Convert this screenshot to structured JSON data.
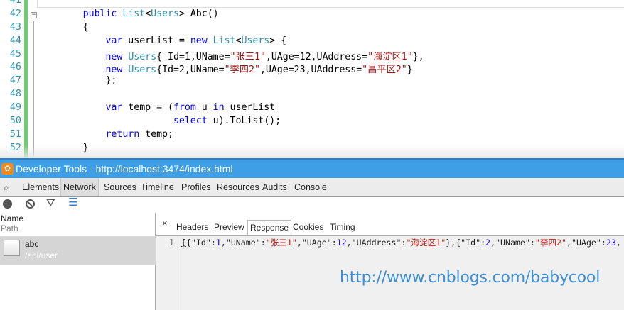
{
  "editor": {
    "line_numbers": [
      "41",
      "42",
      "43",
      "44",
      "45",
      "46",
      "47",
      "48",
      "49",
      "50",
      "51",
      "52"
    ],
    "fold_icon": "minus-box-icon",
    "lines": [
      [],
      [
        [
          "        ",
          "pl"
        ],
        [
          "public",
          "kw"
        ],
        [
          " ",
          "pl"
        ],
        [
          "List",
          "ty"
        ],
        [
          "<",
          "pl"
        ],
        [
          "Users",
          "ty"
        ],
        [
          "> Abc()",
          "pl"
        ]
      ],
      [
        [
          "        {",
          "pl"
        ]
      ],
      [
        [
          "            ",
          "pl"
        ],
        [
          "var",
          "kw"
        ],
        [
          " userList = ",
          "pl"
        ],
        [
          "new",
          "kw"
        ],
        [
          " ",
          "pl"
        ],
        [
          "List",
          "ty"
        ],
        [
          "<",
          "pl"
        ],
        [
          "Users",
          "ty"
        ],
        [
          "> {",
          "pl"
        ]
      ],
      [
        [
          "            ",
          "pl"
        ],
        [
          "new",
          "kw"
        ],
        [
          " ",
          "pl"
        ],
        [
          "Users",
          "ty"
        ],
        [
          "{ Id=1,UName=",
          "pl"
        ],
        [
          "\"张三1\"",
          "st"
        ],
        [
          ",UAge=12,UAddress=",
          "pl"
        ],
        [
          "\"海淀区1\"",
          "st"
        ],
        [
          "},",
          "pl"
        ]
      ],
      [
        [
          "            ",
          "pl"
        ],
        [
          "new",
          "kw"
        ],
        [
          " ",
          "pl"
        ],
        [
          "Users",
          "ty"
        ],
        [
          "{Id=2,UName=",
          "pl"
        ],
        [
          "\"李四2\"",
          "st"
        ],
        [
          ",UAge=23,UAddress=",
          "pl"
        ],
        [
          "\"昌平区2\"",
          "st"
        ],
        [
          "}",
          "pl"
        ]
      ],
      [
        [
          "            };",
          "pl"
        ]
      ],
      [],
      [
        [
          "            ",
          "pl"
        ],
        [
          "var",
          "kw"
        ],
        [
          " temp = (",
          "pl"
        ],
        [
          "from",
          "kw"
        ],
        [
          " u ",
          "pl"
        ],
        [
          "in",
          "kw"
        ],
        [
          " userList",
          "pl"
        ]
      ],
      [
        [
          "                        ",
          "pl"
        ],
        [
          "select",
          "kw"
        ],
        [
          " u).ToList();",
          "pl"
        ]
      ],
      [
        [
          "            ",
          "pl"
        ],
        [
          "return",
          "kw"
        ],
        [
          " temp;",
          "pl"
        ]
      ],
      [
        [
          "        }",
          "pl"
        ]
      ]
    ]
  },
  "devtools": {
    "title": "Developer Tools - http://localhost:3474/index.html",
    "app_icon": "uc-browser-icon",
    "tabs": [
      "Elements",
      "Network",
      "Sources",
      "Timeline",
      "Profiles",
      "Resources",
      "Audits",
      "Console"
    ],
    "active_tab": "Network",
    "toolbar_icons": [
      "record-icon",
      "clear-icon",
      "filter-icon",
      "list-view-icon"
    ],
    "list_header": {
      "name": "Name",
      "path": "Path"
    },
    "requests": [
      {
        "name": "abc",
        "path": "/api/user",
        "selected": true
      }
    ],
    "detail_tabs": [
      "Headers",
      "Preview",
      "Response",
      "Cookies",
      "Timing"
    ],
    "active_detail_tab": "Response",
    "close_label": "×",
    "response_line_number": "1",
    "response_tokens": [
      [
        "[",
        "jp"
      ],
      [
        "{",
        "jp"
      ],
      [
        "\"Id\"",
        "jk"
      ],
      [
        ":",
        "jp"
      ],
      [
        "1",
        "jn"
      ],
      [
        ",",
        "jp"
      ],
      [
        "\"UName\"",
        "jk"
      ],
      [
        ":",
        "jp"
      ],
      [
        "\"张三1\"",
        "js"
      ],
      [
        ",",
        "jp"
      ],
      [
        "\"UAge\"",
        "jk"
      ],
      [
        ":",
        "jp"
      ],
      [
        "12",
        "jn"
      ],
      [
        ",",
        "jp"
      ],
      [
        "\"UAddress\"",
        "jk"
      ],
      [
        ":",
        "jp"
      ],
      [
        "\"海淀区1\"",
        "js"
      ],
      [
        "},{",
        "jp"
      ],
      [
        "\"Id\"",
        "jk"
      ],
      [
        ":",
        "jp"
      ],
      [
        "2",
        "jn"
      ],
      [
        ",",
        "jp"
      ],
      [
        "\"UName\"",
        "jk"
      ],
      [
        ":",
        "jp"
      ],
      [
        "\"李四2\"",
        "js"
      ],
      [
        ",",
        "jp"
      ],
      [
        "\"UAge\"",
        "jk"
      ],
      [
        ":",
        "jp"
      ],
      [
        "23",
        "jn"
      ],
      [
        ",",
        "jp"
      ]
    ]
  },
  "watermark": "http://www.cnblogs.com/babycool",
  "colors": {
    "keyword": "#0000ff",
    "type": "#2b91af",
    "string": "#a31515",
    "titlebar": "#3f9fe6",
    "watermark": "#3a8fd8"
  }
}
